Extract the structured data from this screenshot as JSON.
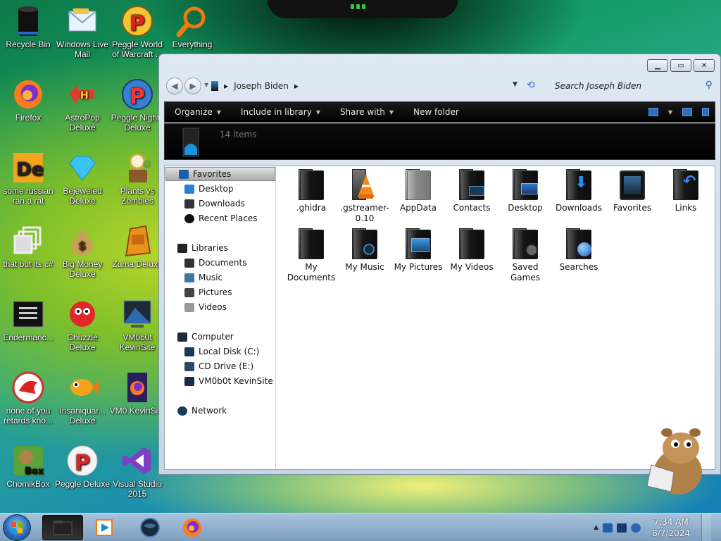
{
  "desktop": {
    "icons": [
      {
        "label": "Recycle Bin",
        "icon": "recycle-bin-icon"
      },
      {
        "label": "Windows Live Mail",
        "icon": "mail-icon"
      },
      {
        "label": "Peggle World of Warcraft ...",
        "icon": "peggle-icon"
      },
      {
        "label": "Everything",
        "icon": "magnifier-icon"
      },
      {
        "label": "Firefox",
        "icon": "firefox-icon"
      },
      {
        "label": "AstroPop Deluxe",
        "icon": "astropop-icon"
      },
      {
        "label": "Peggle Nights Deluxe",
        "icon": "peggle-nights-icon"
      },
      {
        "label": "some russian ran a rat",
        "icon": "de-icon"
      },
      {
        "label": "Bejeweled Deluxe",
        "icon": "gem-icon"
      },
      {
        "label": "Plants vs Zombies",
        "icon": "plant-icon"
      },
      {
        "label": "that but its c#",
        "icon": "copy-icon"
      },
      {
        "label": "Big Money Deluxe",
        "icon": "money-bag-icon"
      },
      {
        "label": "Zuma Deluxe",
        "icon": "zuma-icon"
      },
      {
        "label": "Endermanc...",
        "icon": "terminal-icon"
      },
      {
        "label": "Chuzzle Deluxe",
        "icon": "chuzzle-icon"
      },
      {
        "label": "VM0b0t KevinSite",
        "icon": "vm-icon"
      },
      {
        "label": "none of you retards kno...",
        "icon": "dragon-icon"
      },
      {
        "label": "Insaniquar... Deluxe",
        "icon": "fish-icon"
      },
      {
        "label": "VM0 KevinSi...",
        "icon": "firefox-file-icon"
      },
      {
        "label": "ChomikBox",
        "icon": "hamster-box-icon"
      },
      {
        "label": "Peggle Deluxe",
        "icon": "peggle-deluxe-icon"
      },
      {
        "label": "Visual Studio 2015",
        "icon": "visual-studio-icon"
      }
    ]
  },
  "explorer": {
    "breadcrumb": "Joseph Biden",
    "search_placeholder": "Search Joseph Biden",
    "toolbar": {
      "organize": "Organize",
      "include": "Include in library",
      "share": "Share with",
      "new_folder": "New folder"
    },
    "item_count": "14 items",
    "nav": {
      "favorites": "Favorites",
      "desktop": "Desktop",
      "downloads": "Downloads",
      "recent": "Recent Places",
      "libraries": "Libraries",
      "documents": "Documents",
      "music": "Music",
      "pictures": "Pictures",
      "videos": "Videos",
      "computer": "Computer",
      "local_disk": "Local Disk (C:)",
      "cd_drive": "CD Drive (E:)",
      "vm_drive": "VM0b0t KevinSite",
      "network": "Network"
    },
    "files": [
      {
        "name": ".ghidra"
      },
      {
        "name": ".gstreamer-0.10"
      },
      {
        "name": "AppData"
      },
      {
        "name": "Contacts"
      },
      {
        "name": "Desktop"
      },
      {
        "name": "Downloads"
      },
      {
        "name": "Favorites"
      },
      {
        "name": "Links"
      },
      {
        "name": "My Documents"
      },
      {
        "name": "My Music"
      },
      {
        "name": "My Pictures"
      },
      {
        "name": "My Videos"
      },
      {
        "name": "Saved Games"
      },
      {
        "name": "Searches"
      }
    ]
  },
  "taskbar": {
    "time": "7:34 AM",
    "date": "8/7/2024"
  }
}
